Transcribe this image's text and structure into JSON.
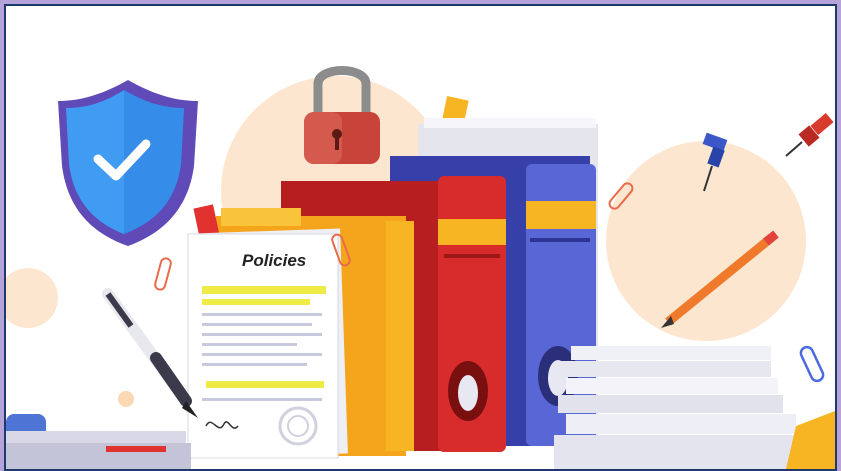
{
  "illustration": {
    "document_title": "Policies",
    "colors": {
      "page_background": "#b5a3d9",
      "border": "#1d3a6b",
      "peach_circle": "#fde3c8",
      "shield": "#3d8ff0",
      "lock": "#c23c34",
      "red_binder": "#d7282a",
      "blue_binder": "#4a55c8",
      "yellow_folder": "#f7b423",
      "highlight": "#f1ee45"
    },
    "icons": [
      "shield-check-icon",
      "padlock-icon",
      "pushpin-icon",
      "pen-icon",
      "pencil-icon",
      "paperclip-icon"
    ]
  }
}
